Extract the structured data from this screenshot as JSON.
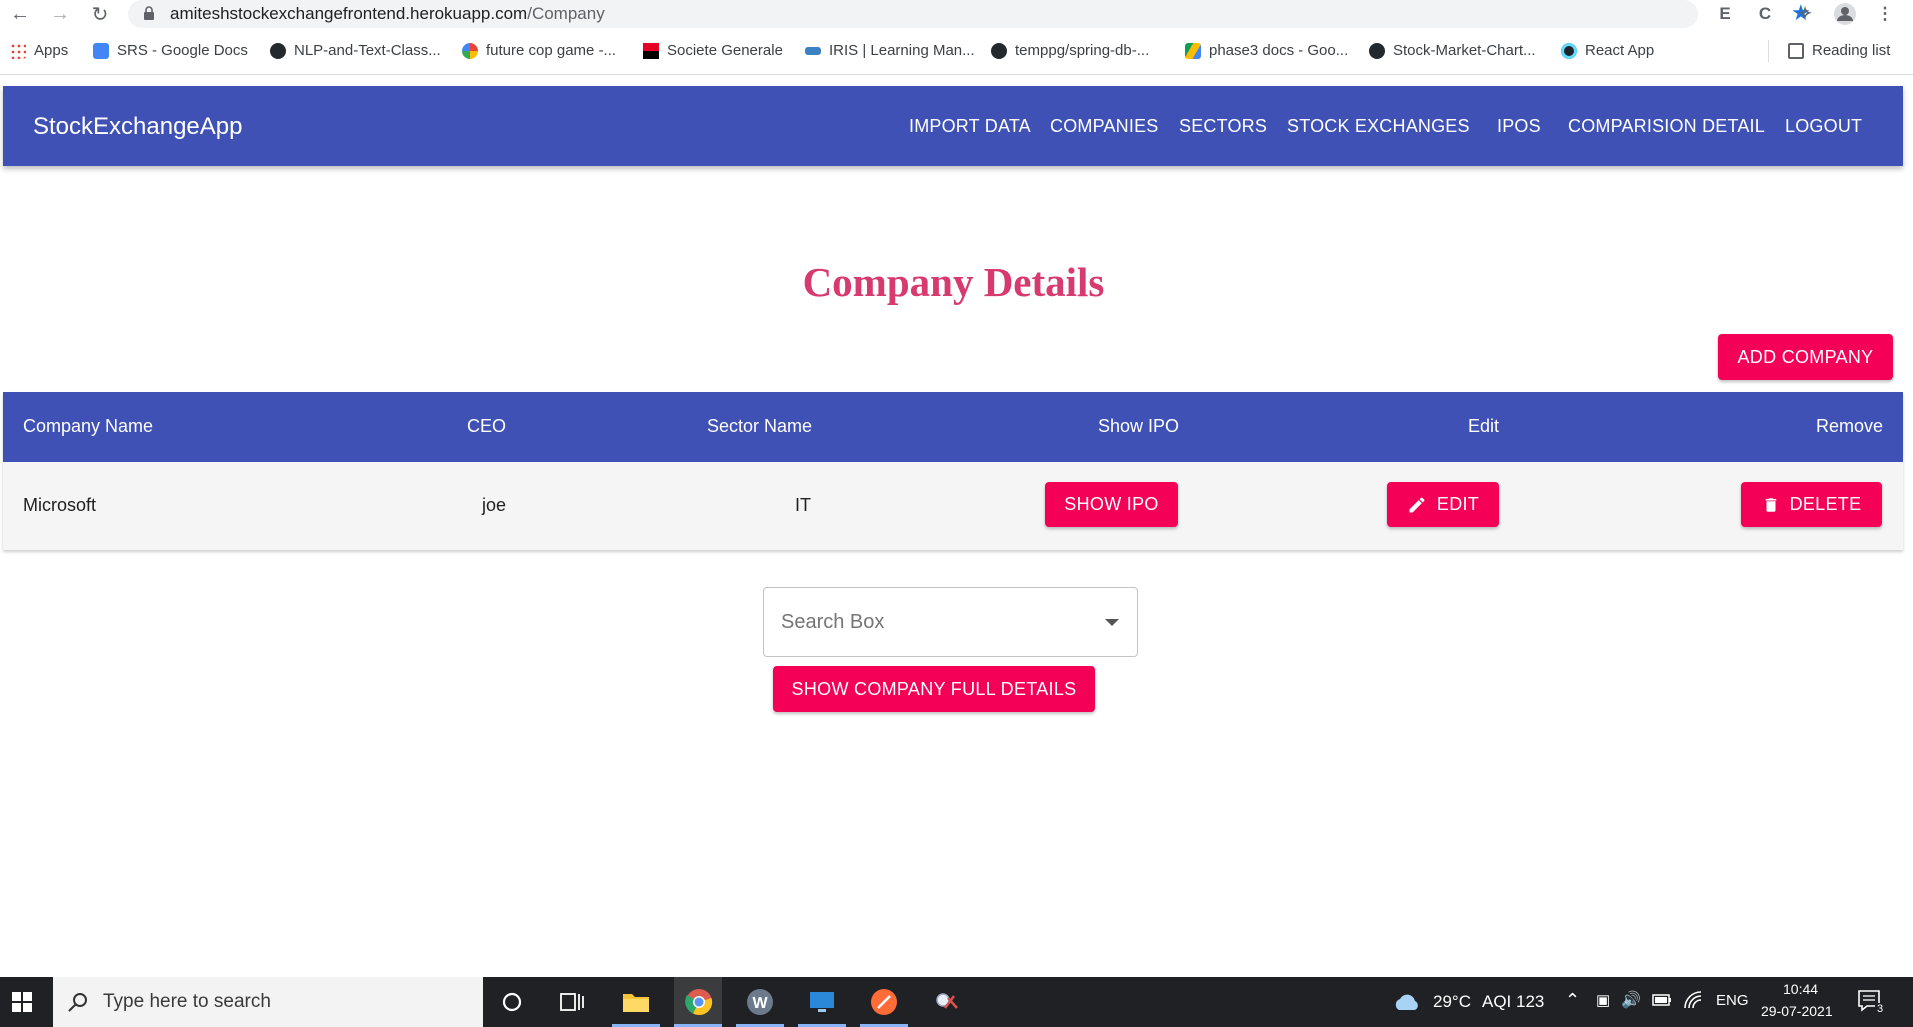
{
  "browser": {
    "url_host": "amiteshstockexchangefrontend.herokuapp.com",
    "url_path": "/Company",
    "bookmarks": [
      {
        "label": "Apps",
        "icon": "apps-grid-icon"
      },
      {
        "label": "SRS - Google Docs",
        "icon": "google-docs-icon"
      },
      {
        "label": "NLP-and-Text-Class...",
        "icon": "github-icon"
      },
      {
        "label": "future cop game -...",
        "icon": "google-icon"
      },
      {
        "label": "Societe Generale",
        "icon": "societe-generale-icon"
      },
      {
        "label": "IRIS | Learning Man...",
        "icon": "iris-icon"
      },
      {
        "label": "temppg/spring-db-...",
        "icon": "github-icon"
      },
      {
        "label": "phase3 docs - Goo...",
        "icon": "google-drive-icon"
      },
      {
        "label": "Stock-Market-Chart...",
        "icon": "github-icon"
      },
      {
        "label": "React App",
        "icon": "react-icon"
      }
    ],
    "reading_list": "Reading list"
  },
  "appbar": {
    "brand": "StockExchangeApp",
    "nav": [
      "IMPORT DATA",
      "COMPANIES",
      "SECTORS",
      "STOCK EXCHANGES",
      "IPOS",
      "COMPARISION DETAIL",
      "LOGOUT"
    ]
  },
  "page": {
    "title": "Company Details",
    "add_button": "ADD COMPANY",
    "table": {
      "headers": [
        "Company Name",
        "CEO",
        "Sector Name",
        "Show IPO",
        "Edit",
        "Remove"
      ],
      "rows": [
        {
          "company": "Microsoft",
          "ceo": "joe",
          "sector": "IT",
          "show_ipo": "SHOW IPO",
          "edit": "EDIT",
          "delete": "DELETE"
        }
      ]
    },
    "search_placeholder": "Search Box",
    "show_details_button": "SHOW COMPANY FULL DETAILS"
  },
  "taskbar": {
    "search_placeholder": "Type here to search",
    "weather": "29°C",
    "aqi": "AQI 123",
    "language": "ENG",
    "time": "10:44",
    "date": "29-07-2021",
    "notifications": "3"
  },
  "colors": {
    "primary": "#3f51b5",
    "accent": "#f50057",
    "title": "#d63a6f"
  }
}
